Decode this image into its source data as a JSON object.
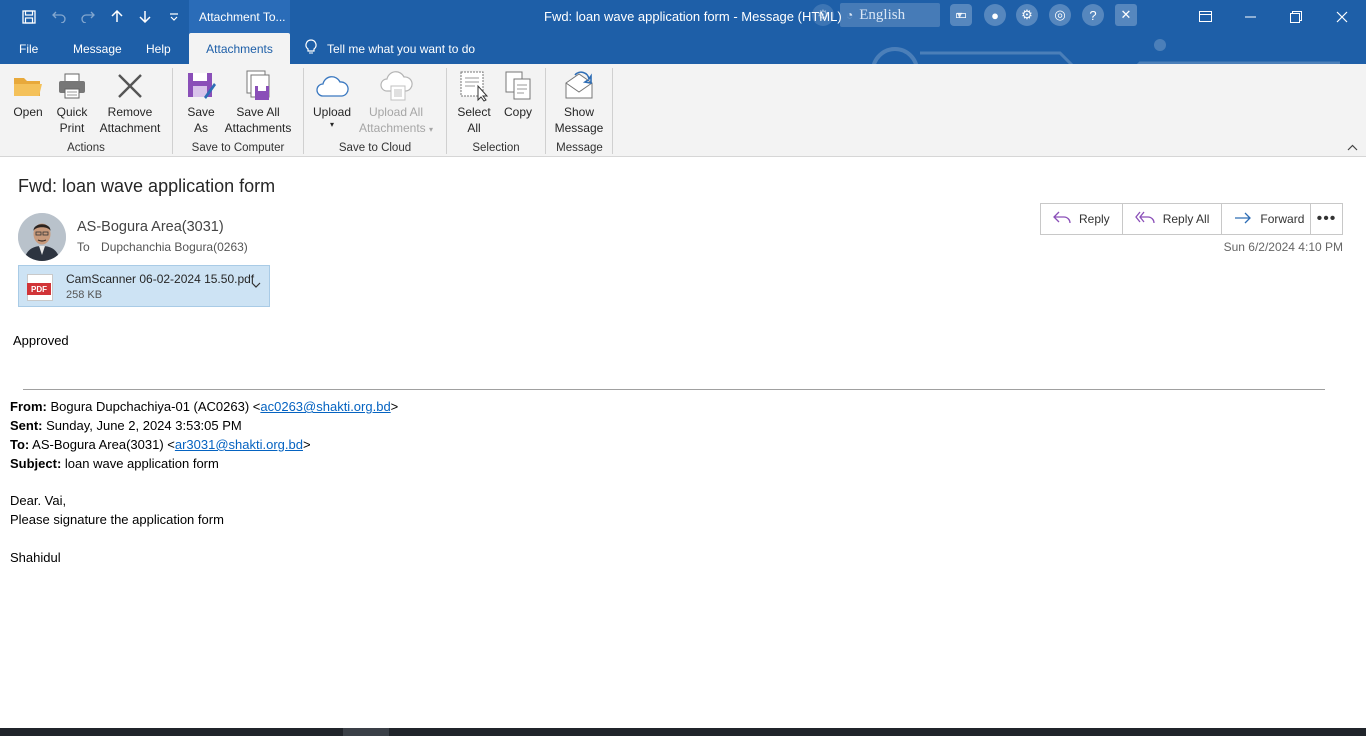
{
  "titlebar": {
    "contextual_tab": "Attachment To...",
    "window_title": "Fwd: loan wave application form  -  Message (HTML)",
    "language": "English",
    "accent": "#1e5fa8"
  },
  "menus": {
    "file": "File",
    "message": "Message",
    "help": "Help",
    "attachments": "Attachments",
    "tell_me": "Tell me what you want to do"
  },
  "ribbon": {
    "actions": {
      "open": "Open",
      "quick_print_1": "Quick",
      "quick_print_2": "Print",
      "remove_1": "Remove",
      "remove_2": "Attachment",
      "label": "Actions"
    },
    "save_to_computer": {
      "save_as_1": "Save",
      "save_as_2": "As",
      "save_all_1": "Save All",
      "save_all_2": "Attachments",
      "label": "Save to Computer"
    },
    "save_to_cloud": {
      "upload": "Upload",
      "upload_all_1": "Upload All",
      "upload_all_2": "Attachments",
      "label": "Save to Cloud"
    },
    "selection": {
      "select_all_1": "Select",
      "select_all_2": "All",
      "copy": "Copy",
      "label": "Selection"
    },
    "message": {
      "show_1": "Show",
      "show_2": "Message",
      "label": "Message"
    }
  },
  "message": {
    "subject": "Fwd: loan wave application form",
    "sender": "AS-Bogura Area(3031)",
    "to_label": "To",
    "to": "Dupchanchia Bogura(0263)",
    "date": "Sun 6/2/2024 4:10 PM",
    "reply": "Reply",
    "reply_all": "Reply All",
    "forward": "Forward",
    "attachment": {
      "type": "PDF",
      "name": "CamScanner 06-02-2024 15.50.pdf",
      "size": "258 KB"
    }
  },
  "body": {
    "approved": "Approved",
    "from_label": "From:",
    "from_name": " Bogura Dupchachiya-01 (AC0263) <",
    "from_email": "ac0263@shakti.org.bd",
    "from_end": ">",
    "sent_label": "Sent:",
    "sent": " Sunday, June 2, 2024 3:53:05 PM",
    "to_label": "To:",
    "to_name": " AS-Bogura Area(3031) <",
    "to_email": "ar3031@shakti.org.bd",
    "to_end": ">",
    "subject_label": "Subject:",
    "subject": " loan wave application form",
    "greeting": "Dear. Vai,",
    "line1": "Please signature the application  form",
    "signature": "Shahidul"
  }
}
